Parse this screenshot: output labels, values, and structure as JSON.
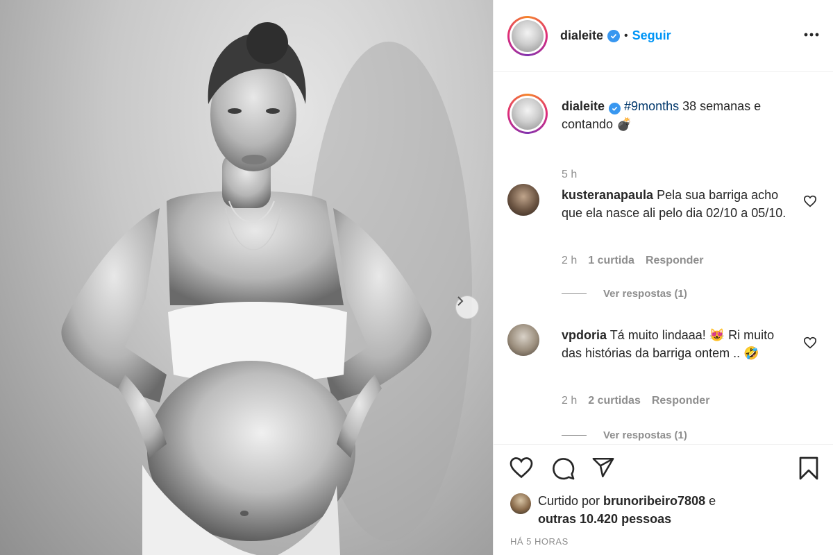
{
  "post": {
    "username": "dialeite",
    "follow_label": "Seguir",
    "separator": "•",
    "caption": {
      "hashtag": "#9months",
      "text": " 38 semanas e contando 💣",
      "time": "5 h"
    }
  },
  "comments": [
    {
      "username": "kusteranapaula",
      "text": " Pela sua barriga acho que ela nasce ali pelo dia 02/10 a 05/10.",
      "time": "2 h",
      "likes": "1 curtida",
      "reply_label": "Responder",
      "view_replies": "Ver respostas (1)"
    },
    {
      "username": "vpdoria",
      "text": " Tá muito lindaaa! 😻 Ri muito das histórias da barriga ontem .. 🤣",
      "time": "2 h",
      "likes": "2 curtidas",
      "reply_label": "Responder",
      "view_replies": "Ver respostas (1)"
    }
  ],
  "likes_summary": {
    "prefix": "Curtido por ",
    "user": "brunoribeiro7808",
    "middle": " e ",
    "others": "outras 10.420 pessoas"
  },
  "time_ago": "HÁ 5 HORAS",
  "icons": {
    "like": "heart-icon",
    "comment": "comment-icon",
    "share": "share-icon",
    "save": "bookmark-icon",
    "more": "more-options-icon",
    "next": "chevron-right-icon",
    "verified": "verified-badge-icon"
  },
  "colors": {
    "link_blue": "#0095f6",
    "hashtag": "#00376b",
    "muted": "#8e8e8e",
    "verified": "#3897f0"
  }
}
